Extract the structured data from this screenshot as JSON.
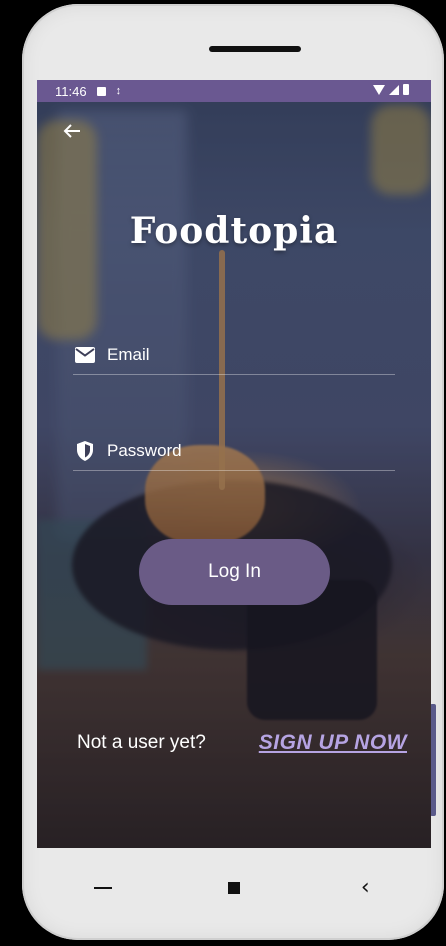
{
  "status_bar": {
    "time": "11:46"
  },
  "app": {
    "title": "Foodtopia"
  },
  "form": {
    "email_placeholder": "Email",
    "password_placeholder": "Password",
    "login_label": "Log In"
  },
  "signup": {
    "prompt": "Not a user yet?",
    "link_label": "SIGN UP NOW"
  },
  "icons": {
    "back": "arrow-left-icon",
    "email": "mail-icon",
    "password": "shield-icon"
  },
  "colors": {
    "status_bar": "#6a5891",
    "login_button": "#6a5b86",
    "signup_link": "#b6a4e3"
  }
}
